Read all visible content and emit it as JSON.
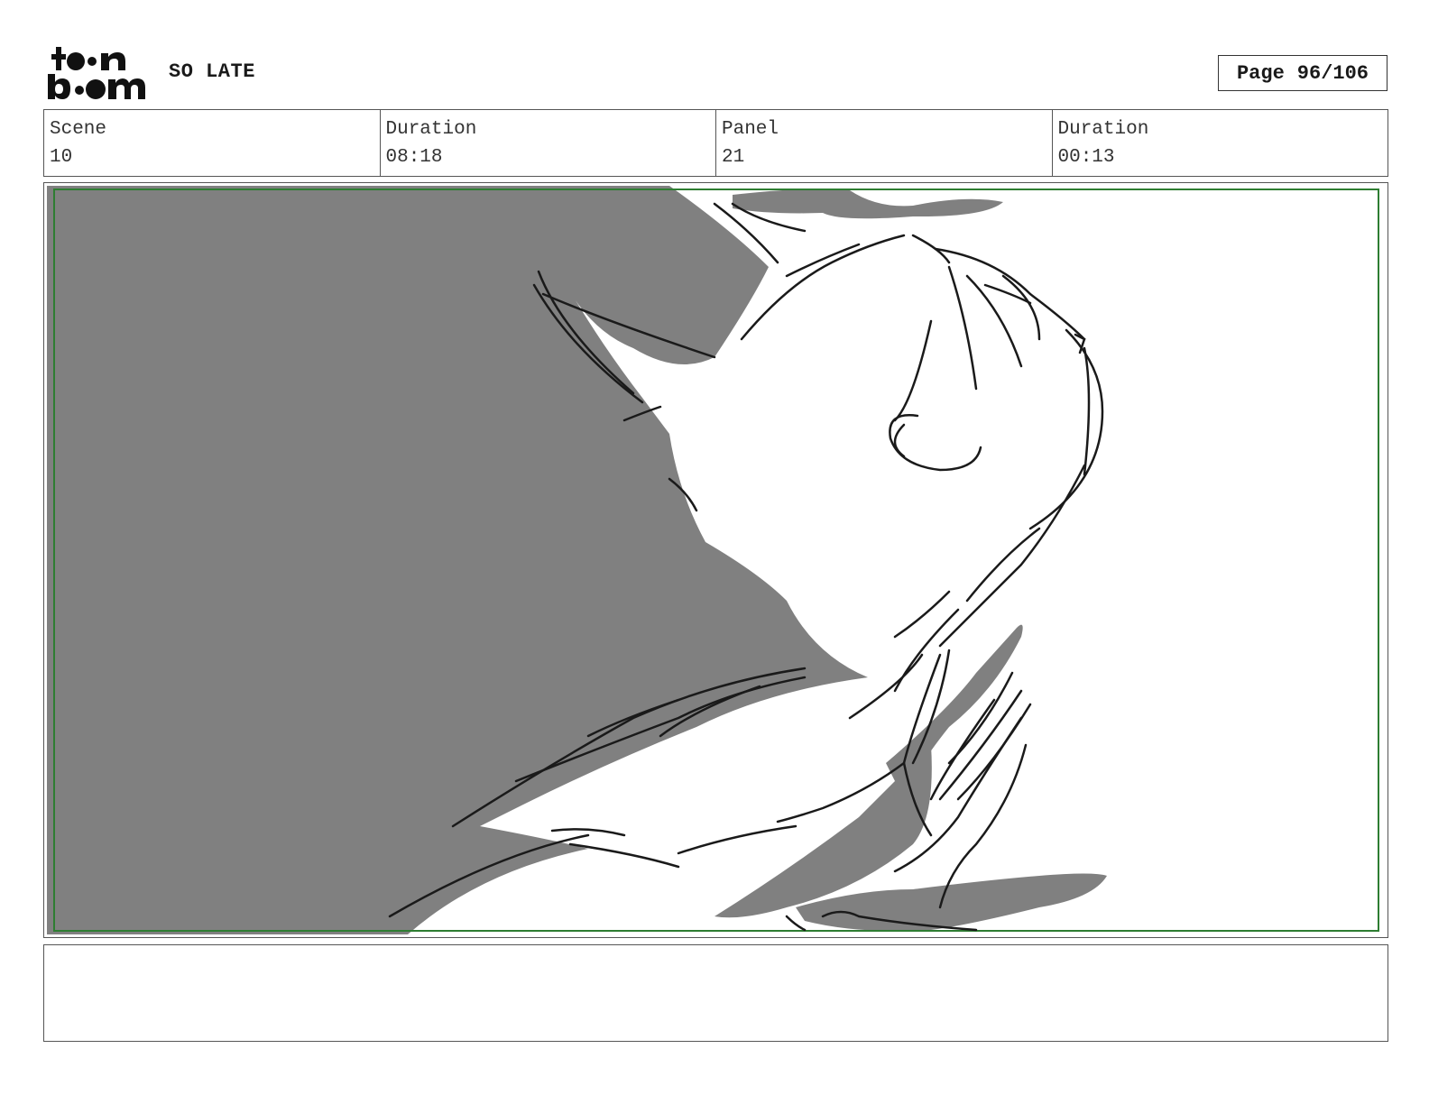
{
  "header": {
    "logo_text": "toonboom",
    "project_title": "SO LATE",
    "page_label": "Page",
    "page_number": "96/106"
  },
  "info": {
    "scene_label": "Scene",
    "scene_value": "10",
    "scene_duration_label": "Duration",
    "scene_duration_value": "08:18",
    "panel_label": "Panel",
    "panel_value": "21",
    "panel_duration_label": "Duration",
    "panel_duration_value": "00:13"
  },
  "panel": {
    "safe_frame_color": "#2e7d32",
    "shadow_color": "#808080",
    "line_color": "#1a1a1a"
  },
  "notes": {
    "text": ""
  }
}
